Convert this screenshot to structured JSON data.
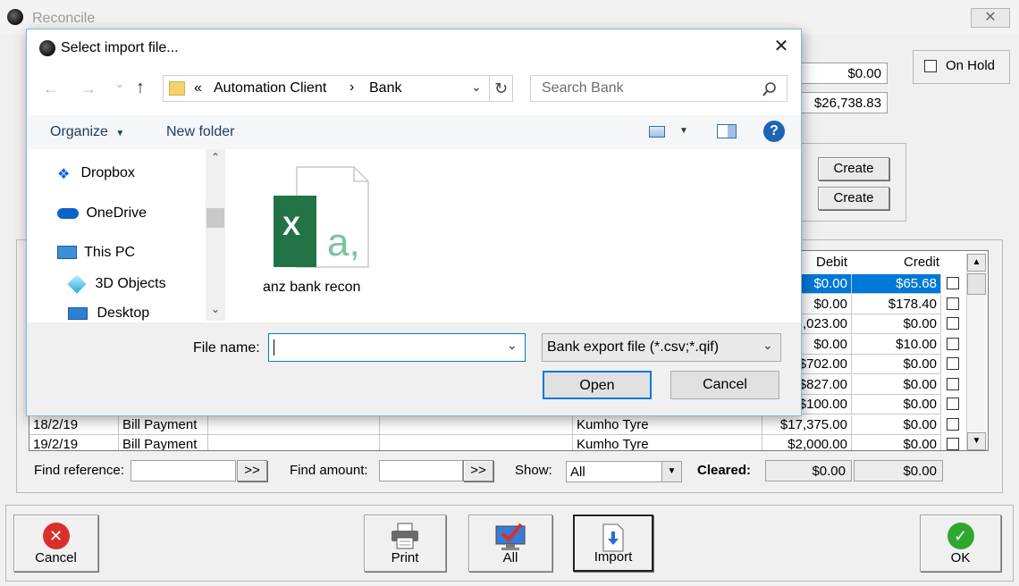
{
  "reconcile": {
    "title": "Reconcile",
    "close_glyph": "✕",
    "amount_top": "$0.00",
    "amount_second": "$26,738.83",
    "on_hold_label": "On Hold",
    "create_label_1": "Create",
    "create_label_2": "Create",
    "grid": {
      "headers": {
        "debit": "Debit",
        "credit": "Credit"
      },
      "rows": [
        {
          "date": "",
          "type": "",
          "ref": "",
          "memo": "",
          "payee": "",
          "debit": "$0.00",
          "credit": "$65.68",
          "selected": true
        },
        {
          "date": "",
          "type": "",
          "ref": "",
          "memo": "",
          "payee": "",
          "debit": "$0.00",
          "credit": "$178.40"
        },
        {
          "date": "",
          "type": "",
          "ref": "",
          "memo": "",
          "payee": "",
          "debit": ",023.00",
          "credit": "$0.00"
        },
        {
          "date": "",
          "type": "",
          "ref": "",
          "memo": "",
          "payee": "",
          "debit": "$0.00",
          "credit": "$10.00"
        },
        {
          "date": "",
          "type": "",
          "ref": "",
          "memo": "",
          "payee": "",
          "debit": "$702.00",
          "credit": "$0.00"
        },
        {
          "date": "",
          "type": "",
          "ref": "",
          "memo": "",
          "payee": "",
          "debit": "$827.00",
          "credit": "$0.00"
        },
        {
          "date": "",
          "type": "",
          "ref": "",
          "memo": "",
          "payee": "",
          "debit": "$100.00",
          "credit": "$0.00"
        },
        {
          "date": "18/2/19",
          "type": "Bill Payment",
          "ref": "",
          "memo": "",
          "payee": "Kumho Tyre",
          "debit": "$17,375.00",
          "credit": "$0.00"
        },
        {
          "date": "19/2/19",
          "type": "Bill Payment",
          "ref": "",
          "memo": "",
          "payee": "Kumho Tyre",
          "debit": "$2,000.00",
          "credit": "$0.00"
        }
      ]
    },
    "find_reference_label": "Find reference:",
    "find_reference_btn": ">>",
    "find_amount_label": "Find amount:",
    "find_amount_btn": ">>",
    "show_label": "Show:",
    "show_value": "All",
    "cleared_label": "Cleared:",
    "cleared_1": "$0.00",
    "cleared_2": "$0.00",
    "toolbar": {
      "cancel": "Cancel",
      "print": "Print",
      "all": "All",
      "import": "Import",
      "ok": "OK"
    }
  },
  "dialog": {
    "title": "Select import file...",
    "close_glyph": "✕",
    "back_glyph": "←",
    "forward_glyph": "→",
    "recent_glyph": "⌄",
    "up_glyph": "↑",
    "breadcrumb": {
      "overflow": "«",
      "part1": "Automation Client",
      "sep": "›",
      "part2": "Bank"
    },
    "search_placeholder": "Search Bank",
    "organize": "Organize",
    "new_folder": "New folder",
    "help_glyph": "?",
    "nav_items": [
      "Dropbox",
      "OneDrive",
      "This PC",
      "3D Objects",
      "Desktop"
    ],
    "file": {
      "name": "anz bank recon",
      "excel_letter": "X",
      "file_letter": "a,"
    },
    "file_name_label": "File name:",
    "file_name_value": "",
    "file_type": "Bank export file (*.csv;*.qif)",
    "open": "Open",
    "cancel": "Cancel"
  },
  "colors": {
    "selection": "#0078d7",
    "excel_green": "#217346",
    "dropbox_blue": "#0061fe",
    "onedrive_blue": "#0a64c8",
    "help_blue": "#1e64b4",
    "cancel_red": "#d9302c",
    "ok_green": "#2fa82f"
  }
}
